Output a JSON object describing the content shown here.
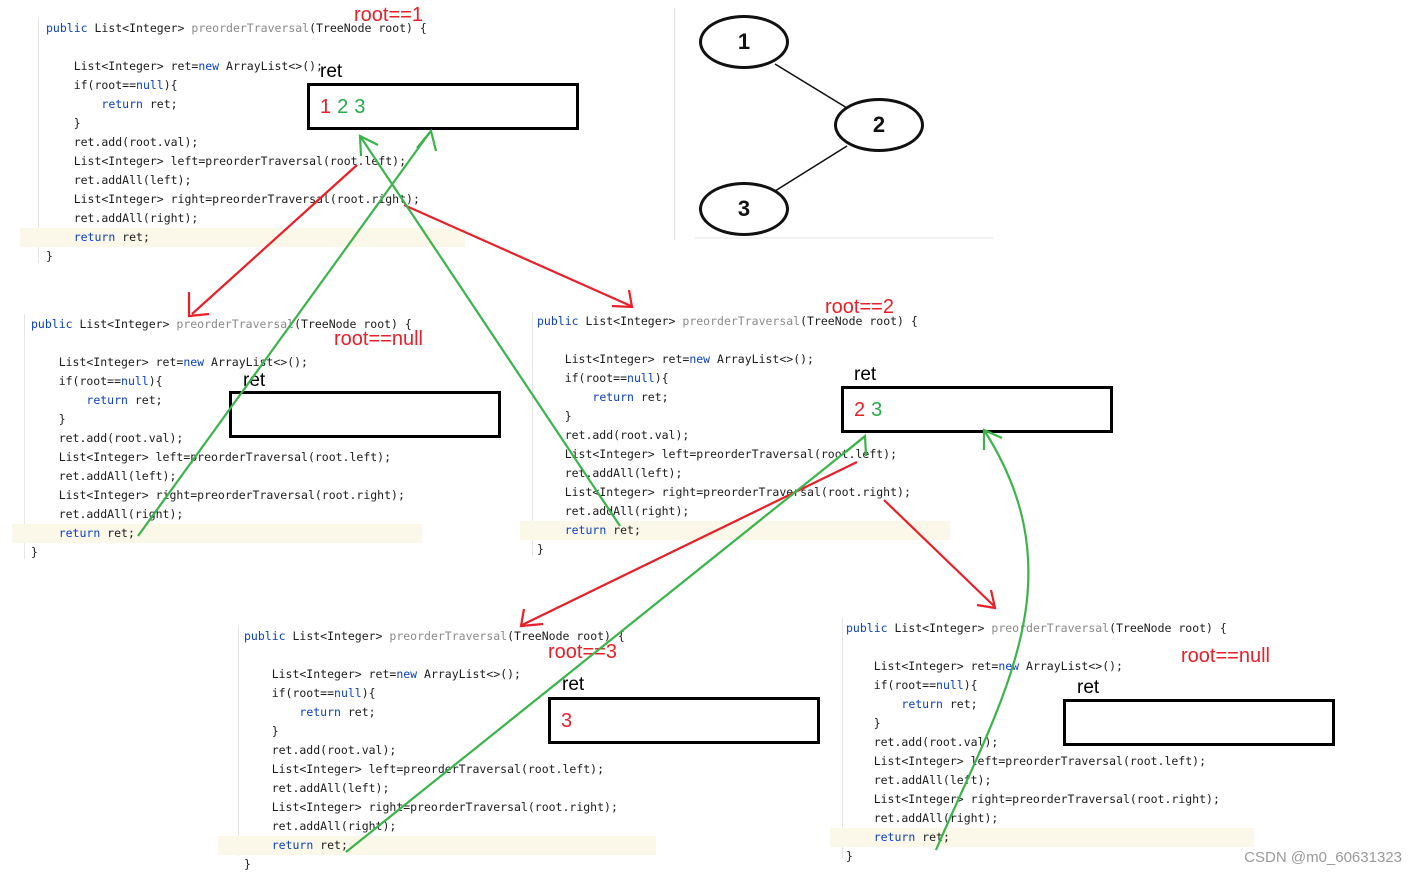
{
  "code_lines": [
    "public List<Integer> preorderTraversal(TreeNode root) {",
    "",
    "    List<Integer> ret=new ArrayList<>();",
    "    if(root==null){",
    "        return ret;",
    "    }",
    "    ret.add(root.val);",
    "    List<Integer> left=preorderTraversal(root.left);",
    "    ret.addAll(left);",
    "    List<Integer> right=preorderTraversal(root.right);",
    "    ret.addAll(right);",
    "    return ret;",
    "}"
  ],
  "frames": [
    {
      "root_label": "root==1",
      "ret_label": "ret",
      "ret_values": [
        {
          "text": "1",
          "color": "#e8202a"
        },
        {
          "text": "2",
          "color": "#2aa84a"
        },
        {
          "text": "3",
          "color": "#2aa84a"
        }
      ]
    },
    {
      "root_label": "root==null",
      "ret_label": "ret",
      "ret_values": []
    },
    {
      "root_label": "root==2",
      "ret_label": "ret",
      "ret_values": [
        {
          "text": "2",
          "color": "#e8202a"
        },
        {
          "text": "3",
          "color": "#2aa84a"
        }
      ]
    },
    {
      "root_label": "root==3",
      "ret_label": "ret",
      "ret_values": [
        {
          "text": "3",
          "color": "#e8202a"
        }
      ]
    },
    {
      "root_label": "root==null",
      "ret_label": "ret",
      "ret_values": []
    }
  ],
  "tree_nodes": [
    "1",
    "2",
    "3"
  ],
  "colors": {
    "call_arrow": "#e8202a",
    "return_arrow": "#3cb44b",
    "keyword": "#0b3fbf"
  },
  "watermark": "CSDN @m0_60631323"
}
